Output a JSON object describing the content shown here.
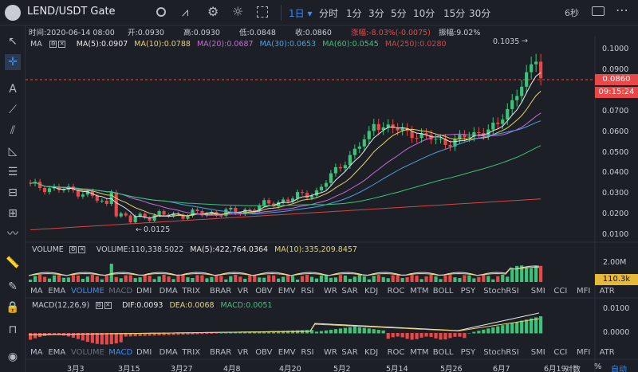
{
  "header": {
    "symbol": "LEND/USDT Gate",
    "timeframes": [
      "1日",
      "分时",
      "1分",
      "3分",
      "5分",
      "10分",
      "15分",
      "30分"
    ],
    "active_timeframe": "1日",
    "countdown": "6秒"
  },
  "info_bar": {
    "time": "时间:2020-06-14 08:00",
    "open": "开:0.0930",
    "high": "高:0.0930",
    "low": "低:0.0848",
    "close": "收:0.0860",
    "change": "涨幅:-8.03%(-0.0075)",
    "amplitude": "振幅:9.02%"
  },
  "main_panel": {
    "indicator": "MA",
    "legend": [
      {
        "label": "MA(5):0.0907",
        "color": "#e8e8e8"
      },
      {
        "label": "MA(10):0.0788",
        "color": "#e8d26a"
      },
      {
        "label": "MA(20):0.0687",
        "color": "#c86ad8"
      },
      {
        "label": "MA(30):0.0653",
        "color": "#4aa0e0"
      },
      {
        "label": "MA(60):0.0545",
        "color": "#3ec27a"
      },
      {
        "label": "MA(250):0.0280",
        "color": "#d04848"
      }
    ],
    "y_ticks": [
      "0.1000",
      "0.0900",
      "0.0800",
      "0.0700",
      "0.0600",
      "0.0500",
      "0.0400",
      "0.0300",
      "0.0200",
      "0.0100"
    ],
    "current_price": "0.0860",
    "countdown_tag": "09:15:24",
    "high_annotation": "0.1035",
    "low_annotation": "0.0125"
  },
  "volume_panel": {
    "indicator": "VOLUME",
    "legend": [
      {
        "label": "VOLUME:110,338.5022",
        "color": "#c9ccd3"
      },
      {
        "label": "MA(5):422,764.0364",
        "color": "#e8e8e8"
      },
      {
        "label": "MA(10):335,209.8457",
        "color": "#e8d26a"
      }
    ],
    "y_ticks": [
      "2.00M"
    ],
    "current_tag": "110.3k"
  },
  "macd_panel": {
    "indicator": "MACD(12,26,9)",
    "legend": [
      {
        "label": "DIF:0.0093",
        "color": "#e8e8e8"
      },
      {
        "label": "DEA:0.0068",
        "color": "#e8d26a"
      },
      {
        "label": "MACD:0.0051",
        "color": "#3ec27a"
      }
    ],
    "y_ticks": [
      "0.0100",
      "0.0000"
    ]
  },
  "indicator_tabs": [
    "MA",
    "EMA",
    "VOLUME",
    "MACD",
    "DMI",
    "DMA",
    "TRIX",
    "BRAR",
    "VR",
    "OBV",
    "EMV",
    "RSI",
    "WR",
    "SAR",
    "KDJ",
    "ROC",
    "MTM",
    "BOLL",
    "PSY",
    "StochRSI",
    "SMI",
    "CCI",
    "MFI",
    "ATR"
  ],
  "indicator_tabs_2": [
    "MA",
    "EMA",
    "VOLUME",
    "MACD",
    "DMI",
    "DMA",
    "TRIX",
    "BRAR",
    "VR",
    "OBV",
    "EMV",
    "RSI",
    "WR",
    "SAR",
    "KDJ",
    "ROC",
    "MTM",
    "BOLL",
    "PSY",
    "StochRSI",
    "SMI",
    "CCI",
    "MFI",
    "ATR"
  ],
  "x_axis": [
    "3月3",
    "3月15",
    "3月27",
    "4月8",
    "4月20",
    "5月2",
    "5月14",
    "5月26",
    "6月7",
    "6月19"
  ],
  "bottom_right": {
    "percent": "%",
    "log": "对数",
    "auto": "自动"
  },
  "colors": {
    "up": "#3ec27a",
    "down": "#e84848",
    "accent": "#3d8cf0",
    "bg": "#1c1f26",
    "grid": "#2b2f38"
  }
}
